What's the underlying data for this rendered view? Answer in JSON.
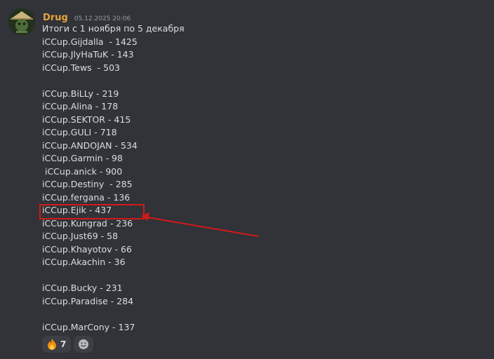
{
  "message": {
    "author": "Drug",
    "timestamp": "05.12.2025 20:06",
    "lines": [
      "Итоги с 1 ноября по 5 декабря",
      "iCCup.Gijdalla  - 1425",
      "iCCup.JlyHaTuK - 143",
      "iCCup.Tews  - 503",
      "",
      "iCCup.BiLLy - 219",
      "iCCup.Alina - 178",
      "iCCup.SEKTOR - 415",
      "iCCup.GULI - 718",
      "iCCup.ANDOJAN - 534",
      "iCCup.Garmin - 98",
      " iCCup.anick - 900",
      "iCCup.Destiny  - 285",
      "iCCup.fergana - 136",
      "iCCup.Ejik - 437",
      "iCCup.Kungrad - 236",
      "iCCup.Just69 - 58",
      "iCCup.Khayotov - 66",
      "iCCup.Akachin - 36",
      "",
      "iCCup.Bucky - 231",
      "iCCup.Paradise - 284",
      "",
      "iCCup.MarCony - 137"
    ]
  },
  "reactions": [
    {
      "icon": "fire-emoji-icon",
      "count": "7"
    },
    {
      "icon": "add-reaction-icon"
    }
  ],
  "colors": {
    "background": "#313338",
    "author": "#e7a43b",
    "text": "#dbdee1",
    "timestamp": "#949ba4",
    "annotation": "#d21a1a"
  }
}
